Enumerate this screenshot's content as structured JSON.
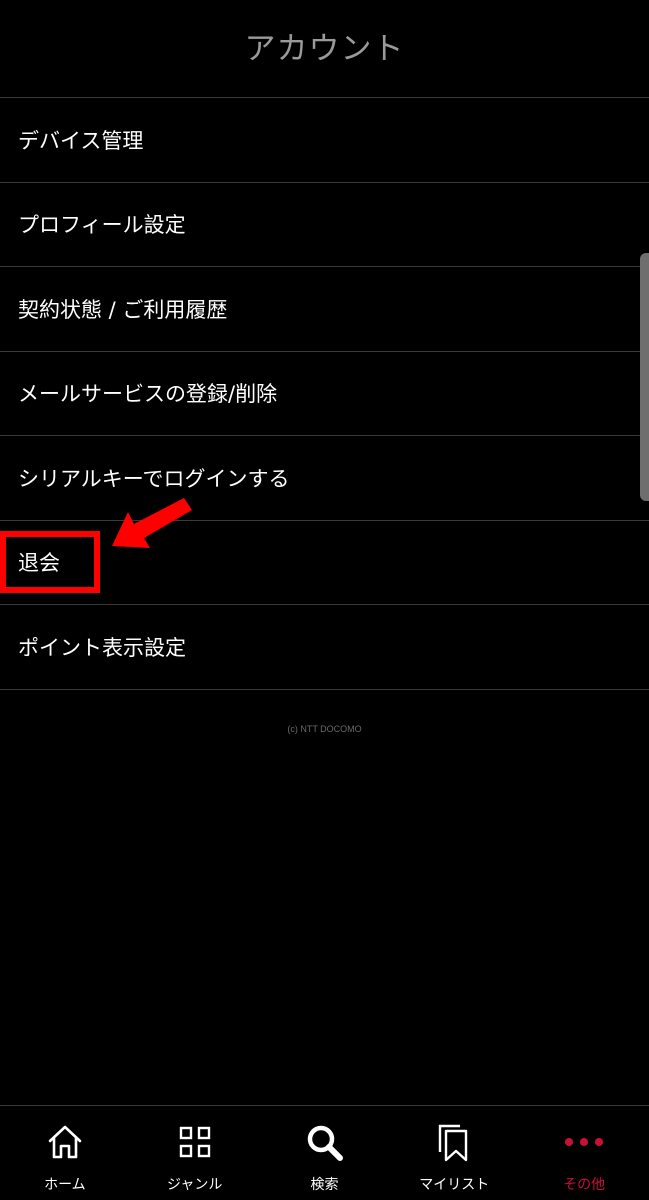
{
  "header": {
    "title": "アカウント"
  },
  "menu": {
    "items": [
      {
        "label": "デバイス管理"
      },
      {
        "label": "プロフィール設定"
      },
      {
        "label": "契約状態 / ご利用履歴"
      },
      {
        "label": "メールサービスの登録/削除"
      },
      {
        "label": "シリアルキーでログインする"
      },
      {
        "label": "退会"
      },
      {
        "label": "ポイント表示設定"
      }
    ]
  },
  "footer": {
    "copyright": "(c) NTT DOCOMO"
  },
  "bottom_nav": {
    "items": [
      {
        "label": "ホーム",
        "icon": "home-icon"
      },
      {
        "label": "ジャンル",
        "icon": "grid-icon"
      },
      {
        "label": "検索",
        "icon": "search-icon"
      },
      {
        "label": "マイリスト",
        "icon": "bookmark-icon"
      },
      {
        "label": "その他",
        "icon": "more-icon",
        "active": true
      }
    ]
  },
  "colors": {
    "background": "#000000",
    "active": "#c8103a",
    "annotation": "#ff0000",
    "divider": "#3a3a3a"
  }
}
